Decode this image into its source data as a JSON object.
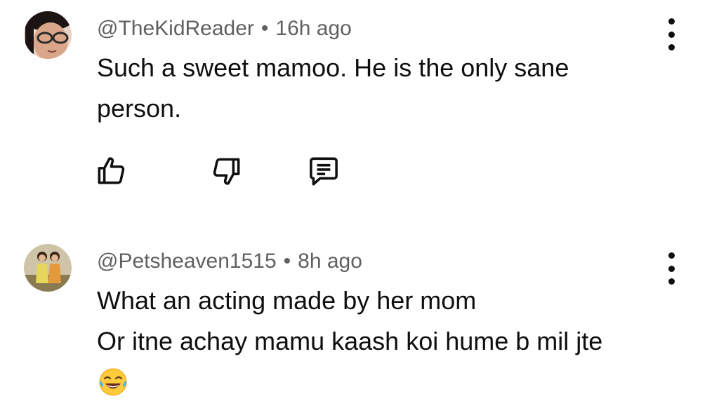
{
  "comments": [
    {
      "handle": "@TheKidReader",
      "separator": "•",
      "time": "16h ago",
      "lines": [
        "Such a sweet mamoo. He is the only sane",
        "person."
      ],
      "avatar_icon": "user-avatar-glasses-icon"
    },
    {
      "handle": "@Petsheaven1515",
      "separator": "•",
      "time": "8h ago",
      "lines": [
        "What an acting made by her mom",
        "Or itne achay mamu kaash koi hume b mil jte"
      ],
      "emoji": "face-with-tears-of-joy-icon",
      "avatar_icon": "user-avatar-two-girls-icon"
    }
  ],
  "actions": {
    "like_icon": "thumbs-up-icon",
    "dislike_icon": "thumbs-down-icon",
    "reply_icon": "reply-comment-icon",
    "more_icon": "more-vert-icon"
  },
  "colors": {
    "text": "#0f0f0f",
    "meta": "#606060",
    "background": "#ffffff"
  }
}
